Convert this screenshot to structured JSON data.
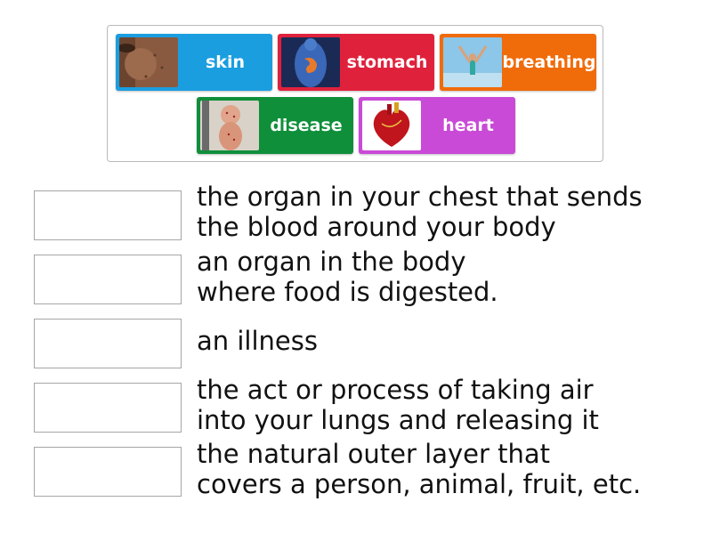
{
  "cards": [
    {
      "label": "skin",
      "color": "#1a9ee0",
      "icon": "skin-closeup-photo-icon"
    },
    {
      "label": "stomach",
      "color": "#e0213c",
      "icon": "stomach-anatomy-photo-icon"
    },
    {
      "label": "breathing",
      "color": "#f06b0a",
      "icon": "breathing-person-photo-icon"
    },
    {
      "label": "disease",
      "color": "#0f8f3a",
      "icon": "sick-child-photo-icon"
    },
    {
      "label": "heart",
      "color": "#c94ad6",
      "icon": "heart-anatomy-photo-icon"
    }
  ],
  "definitions": [
    {
      "line1": "the organ in your chest that sends",
      "line2": "the blood around your body"
    },
    {
      "line1": "an organ in the body",
      "line2": "where food is digested."
    },
    {
      "line1": "an illness",
      "line2": ""
    },
    {
      "line1": "the act or process of taking air",
      "line2": "into your lungs and releasing it"
    },
    {
      "line1": "the natural outer layer that",
      "line2": "covers a person, animal, fruit, etc."
    }
  ]
}
